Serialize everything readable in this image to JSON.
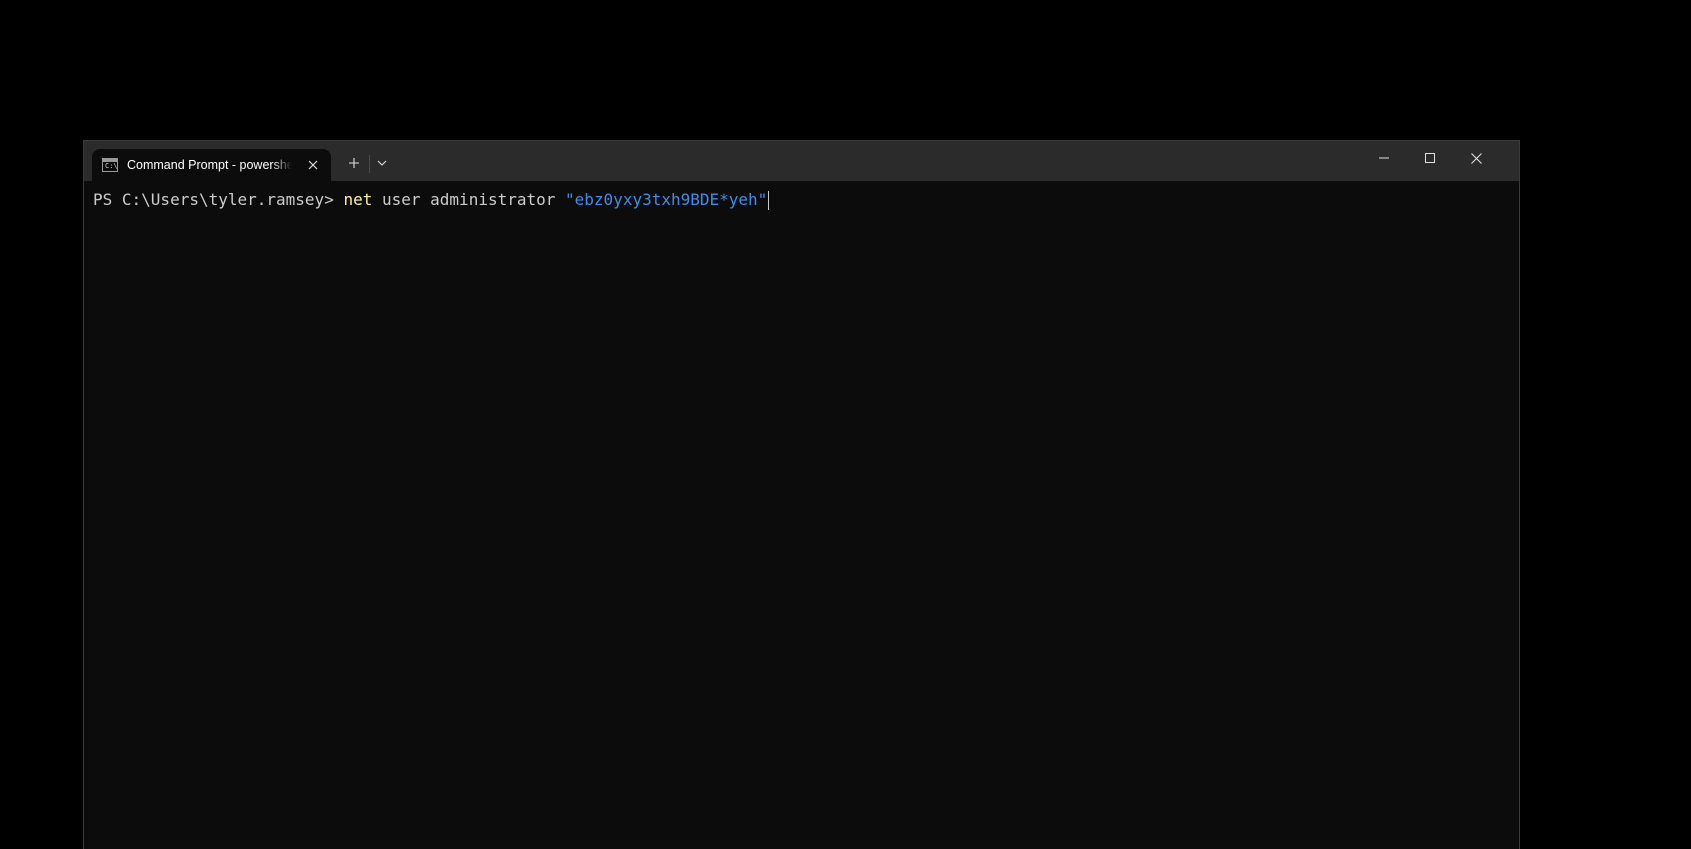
{
  "window": {
    "tab_title": "Command Prompt - powershell",
    "tab_icon": "console-icon",
    "tab_icon_glyph": "C:\\",
    "controls": {
      "new_tab": "plus-icon",
      "dropdown": "chevron-down-icon",
      "minimize": "minimize-icon",
      "maximize": "maximize-icon",
      "close": "close-icon"
    }
  },
  "terminal": {
    "prompt": "PS C:\\Users\\tyler.ramsey> ",
    "command": "net",
    "args": " user administrator ",
    "string_arg": "\"ebz0yxy3txh9BDE*yeh\""
  },
  "colors": {
    "background": "#0c0c0c",
    "titlebar": "#2b2b2b",
    "text": "#cccccc",
    "keyword": "#f9f1a5",
    "string": "#3b8eea"
  }
}
